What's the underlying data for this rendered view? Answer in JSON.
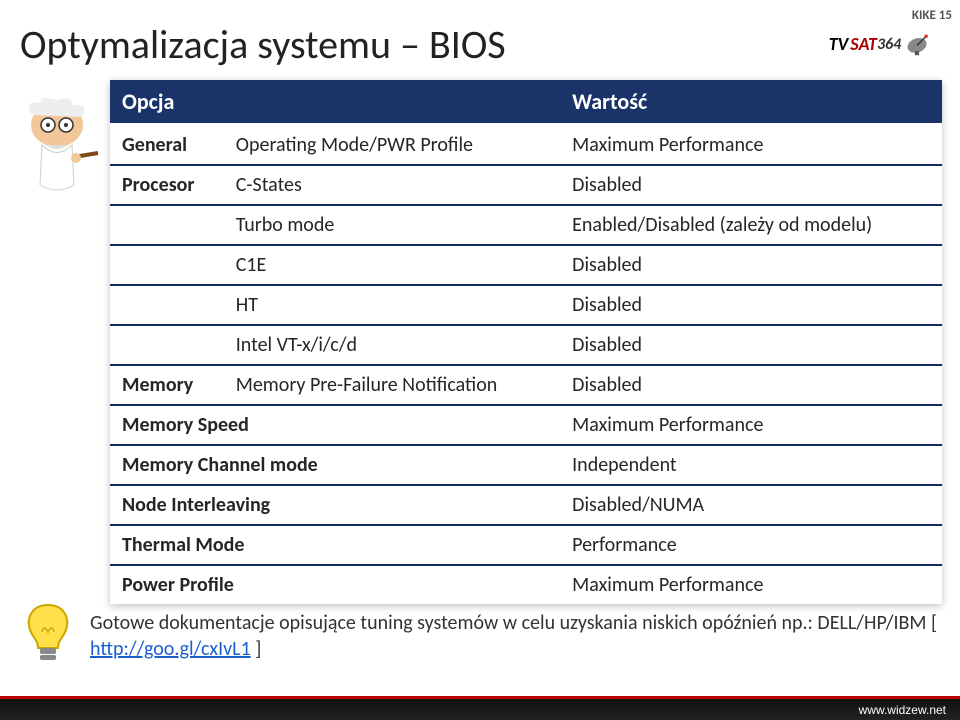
{
  "badge": "KIKE 15",
  "title": "Optymalizacja systemu – BIOS",
  "logo": {
    "tv": "TV",
    "sat": "SAT",
    "num": "364"
  },
  "table": {
    "headers": [
      "Opcja",
      "",
      "Wartość"
    ],
    "rows": [
      {
        "cat": "General",
        "opt": "Operating Mode/PWR Profile",
        "val": "Maximum Performance"
      },
      {
        "cat": "Procesor",
        "opt": "C-States",
        "val": "Disabled"
      },
      {
        "cat": "",
        "opt": "Turbo mode",
        "val": "Enabled/Disabled (zależy od modelu)"
      },
      {
        "cat": "",
        "opt": "C1E",
        "val": "Disabled"
      },
      {
        "cat": "",
        "opt": "HT",
        "val": "Disabled"
      },
      {
        "cat": "",
        "opt": "Intel VT-x/i/c/d",
        "val": "Disabled"
      },
      {
        "cat": "Memory",
        "opt": "Memory Pre-Failure Notification",
        "val": "Disabled"
      },
      {
        "cat": "Memory Speed",
        "opt": "",
        "val": "Maximum Performance"
      },
      {
        "cat": "Memory Channel mode",
        "opt": "",
        "val": "Independent"
      },
      {
        "cat": "Node Interleaving",
        "opt": "",
        "val": "Disabled/NUMA"
      },
      {
        "cat": "Thermal Mode",
        "opt": "",
        "val": "Performance"
      },
      {
        "cat": "Power Profile",
        "opt": "",
        "val": "Maximum Performance"
      }
    ]
  },
  "footnote": {
    "text_before": "Gotowe dokumentacje opisujące tuning systemów w celu uzyskania niskich opóźnień np.: DELL/HP/IBM  [ ",
    "link_text": "http://goo.gl/cxIvL1",
    "text_after": " ]"
  },
  "footer": "www.widzew.net"
}
